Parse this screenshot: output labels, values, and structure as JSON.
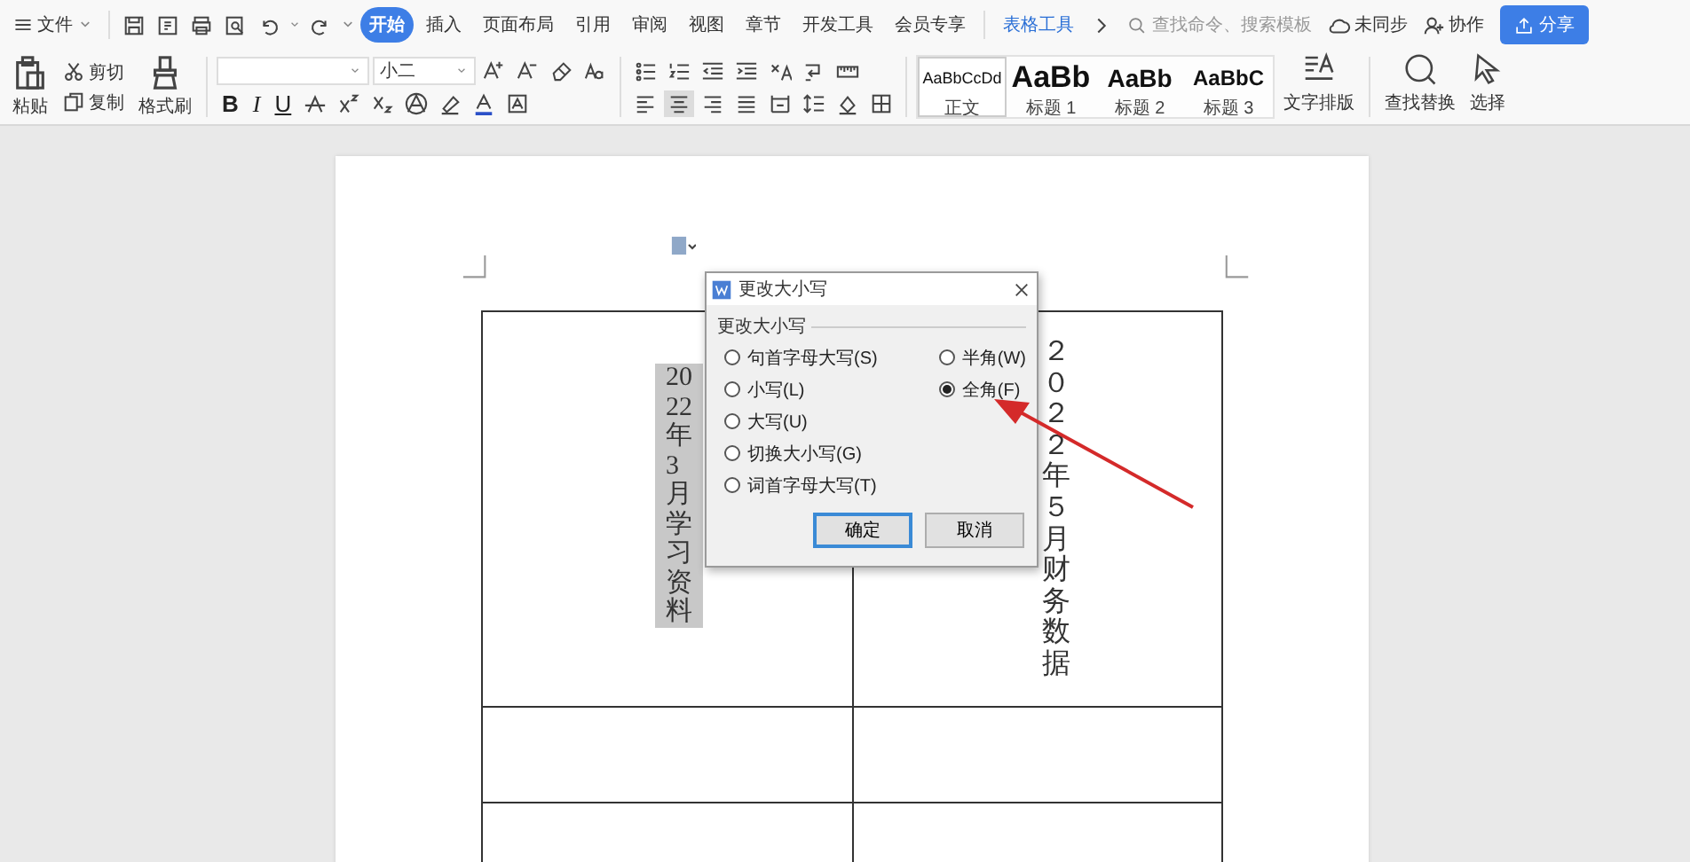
{
  "menu_bar": {
    "file": "文件",
    "tabs": [
      {
        "label": "开始",
        "selected": true,
        "kind": "normal"
      },
      {
        "label": "插入",
        "selected": false,
        "kind": "normal"
      },
      {
        "label": "页面布局",
        "selected": false,
        "kind": "normal"
      },
      {
        "label": "引用",
        "selected": false,
        "kind": "normal"
      },
      {
        "label": "审阅",
        "selected": false,
        "kind": "normal"
      },
      {
        "label": "视图",
        "selected": false,
        "kind": "normal"
      },
      {
        "label": "章节",
        "selected": false,
        "kind": "normal"
      },
      {
        "label": "开发工具",
        "selected": false,
        "kind": "normal"
      },
      {
        "label": "会员专享",
        "selected": false,
        "kind": "normal"
      },
      {
        "label": "表格工具",
        "selected": false,
        "kind": "contextual"
      }
    ],
    "search": {
      "placeholder": "查找命令、搜索模板"
    },
    "sync": "未同步",
    "collab": "协作",
    "share": "分享"
  },
  "ribbon": {
    "clipboard": {
      "paste": "粘贴",
      "cut": "剪切",
      "copy": "复制",
      "format_painter": "格式刷"
    },
    "font": {
      "size": "小二",
      "bold": "B",
      "italic": "I",
      "underline": "U"
    },
    "align_buttons": [
      {
        "selected": false
      },
      {
        "selected": true
      },
      {
        "selected": false
      },
      {
        "selected": false
      },
      {
        "selected": false
      }
    ],
    "styles": [
      {
        "preview": "AaBbCcDd",
        "label": "正文",
        "kind": "body",
        "selected": true
      },
      {
        "preview": "AaBb",
        "label": "标题 1",
        "kind": "heading1",
        "selected": false
      },
      {
        "preview": "AaBb",
        "label": "标题 2",
        "kind": "heading2",
        "selected": false
      },
      {
        "preview": "AaBbC",
        "label": "标题 3",
        "kind": "heading3",
        "selected": false
      }
    ],
    "text_layout": "文字排版",
    "find_replace": "查找替换",
    "select": "选择"
  },
  "document": {
    "table": {
      "rows": [
        {
          "cells": [
            {
              "text": "2022 年 3 月学习资料",
              "highlighted": true
            },
            {
              "text": "２０２２年５月财务数据",
              "highlighted": false
            }
          ]
        },
        {
          "cells": [
            {},
            {}
          ]
        },
        {
          "cells": [
            {},
            {}
          ]
        }
      ]
    }
  },
  "dialog": {
    "title": "更改大小写",
    "group_label": "更改大小写",
    "left_options": [
      {
        "label": "句首字母大写(S)",
        "selected": false
      },
      {
        "label": "小写(L)",
        "selected": false
      },
      {
        "label": "大写(U)",
        "selected": false
      },
      {
        "label": "切换大小写(G)",
        "selected": false
      },
      {
        "label": "词首字母大写(T)",
        "selected": false
      }
    ],
    "right_options": [
      {
        "label": "半角(W)",
        "selected": false
      },
      {
        "label": "全角(F)",
        "selected": true
      }
    ],
    "buttons": [
      {
        "label": "确定",
        "default": true
      },
      {
        "label": "取消",
        "default": false
      }
    ]
  }
}
